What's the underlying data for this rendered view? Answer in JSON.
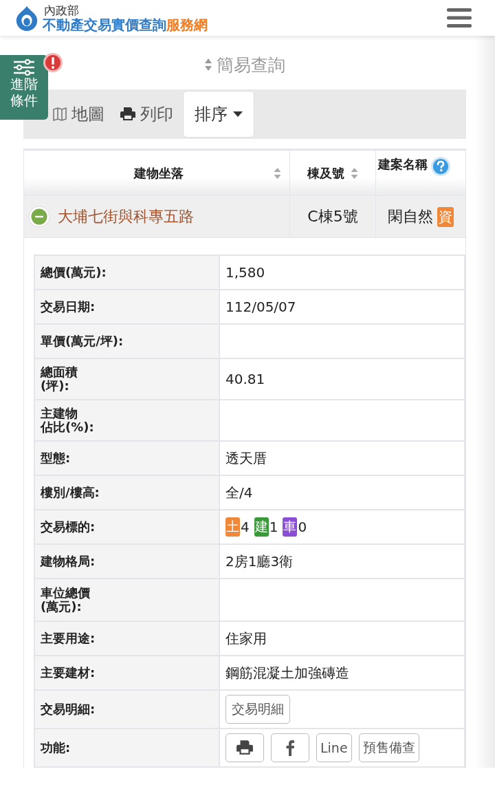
{
  "header": {
    "ministry": "內政部",
    "title": "不動產交易實價查詢",
    "title_suffix": "服務網"
  },
  "advanced_filter": {
    "label_lines": [
      "進階",
      "條件"
    ],
    "alert": true
  },
  "simple_search": {
    "label": "簡易查詢"
  },
  "toolbar": {
    "map": "地圖",
    "print": "列印",
    "sort": "排序"
  },
  "table": {
    "columns": [
      {
        "label": "建物坐落",
        "sortable": true
      },
      {
        "label": "棟及號",
        "sortable": true
      },
      {
        "label": "建案名稱",
        "sortable": false
      }
    ],
    "rows": [
      {
        "expanded": true,
        "address": "大埔七街與科專五路",
        "unit": "C棟5號",
        "project": "閑自然",
        "project_badge": "資"
      }
    ]
  },
  "details": [
    {
      "kind": "text",
      "label": [
        "總價(萬元):"
      ],
      "value": "1,580"
    },
    {
      "kind": "text",
      "label": [
        "交易日期:"
      ],
      "value": "112/05/07"
    },
    {
      "kind": "text",
      "label": [
        "單價(萬元/坪):"
      ]
    },
    {
      "kind": "text",
      "label": [
        "總面積",
        "(坪):"
      ],
      "value": "40.81"
    },
    {
      "kind": "text",
      "label": [
        "主建物",
        "佔比(%):"
      ]
    },
    {
      "kind": "text",
      "label": [
        "型態:"
      ],
      "value": "透天厝"
    },
    {
      "kind": "text",
      "label": [
        "樓別/樓高:"
      ],
      "value": "全/4"
    },
    {
      "kind": "tags",
      "label": [
        "交易標的:"
      ],
      "tags": [
        {
          "label": "土",
          "count": "4",
          "color": "#f0883a"
        },
        {
          "label": "建",
          "count": "1",
          "color": "#3a9a3a"
        },
        {
          "label": "車",
          "count": "0",
          "color": "#8b4fd6"
        }
      ]
    },
    {
      "kind": "text",
      "label": [
        "建物格局:"
      ],
      "value": "2房1廳3衛"
    },
    {
      "kind": "text",
      "label": [
        "車位總價",
        "(萬元):"
      ]
    },
    {
      "kind": "text",
      "label": [
        "主要用途:"
      ],
      "value": "住家用"
    },
    {
      "kind": "text",
      "label": [
        "主要建材:"
      ],
      "value": "鋼筋混凝土加強磚造"
    },
    {
      "kind": "button",
      "label": [
        "交易明細:"
      ],
      "button": "交易明細"
    },
    {
      "kind": "actions",
      "label": [
        "功能:"
      ],
      "actions": [
        {
          "kind": "print"
        },
        {
          "kind": "facebook"
        },
        {
          "kind": "text",
          "label": "Line"
        },
        {
          "kind": "text",
          "label": "預售備查"
        }
      ]
    }
  ]
}
